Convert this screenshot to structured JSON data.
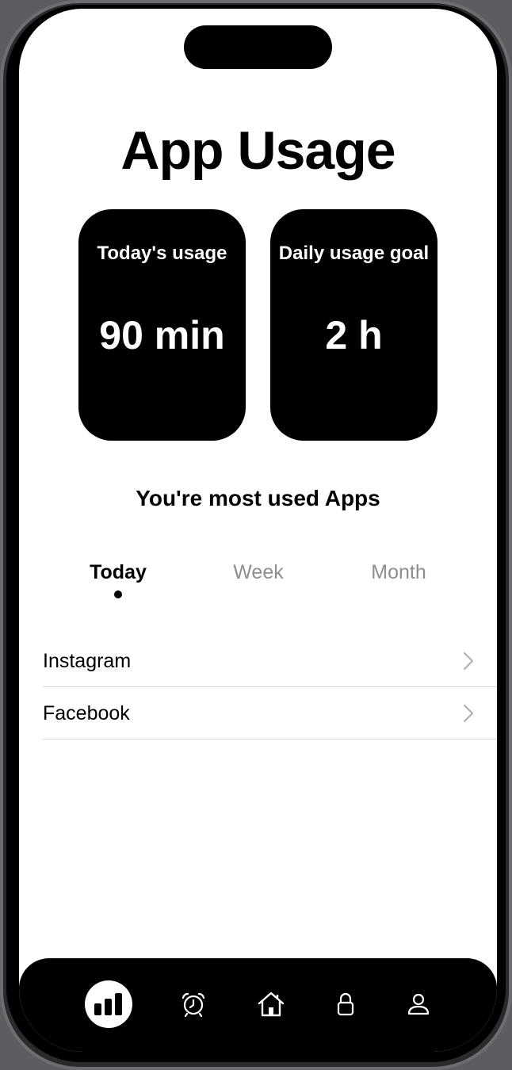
{
  "page": {
    "title": "App Usage"
  },
  "cards": [
    {
      "label": "Today's usage",
      "value": "90 min"
    },
    {
      "label": "Daily usage goal",
      "value": "2 h"
    }
  ],
  "section": {
    "title": "You're most used Apps"
  },
  "segments": {
    "items": [
      "Today",
      "Week",
      "Month"
    ],
    "selected": "Today"
  },
  "apps": [
    {
      "name": "Instagram"
    },
    {
      "name": "Facebook"
    }
  ],
  "tabbar": {
    "items": [
      {
        "icon": "bar-chart-icon",
        "selected": true
      },
      {
        "icon": "alarm-clock-icon",
        "selected": false
      },
      {
        "icon": "home-icon",
        "selected": false
      },
      {
        "icon": "lock-icon",
        "selected": false
      },
      {
        "icon": "person-icon",
        "selected": false
      }
    ]
  },
  "colors": {
    "accent": "#000000",
    "inactive_segment": "#8e8e93",
    "background": "#ffffff"
  }
}
